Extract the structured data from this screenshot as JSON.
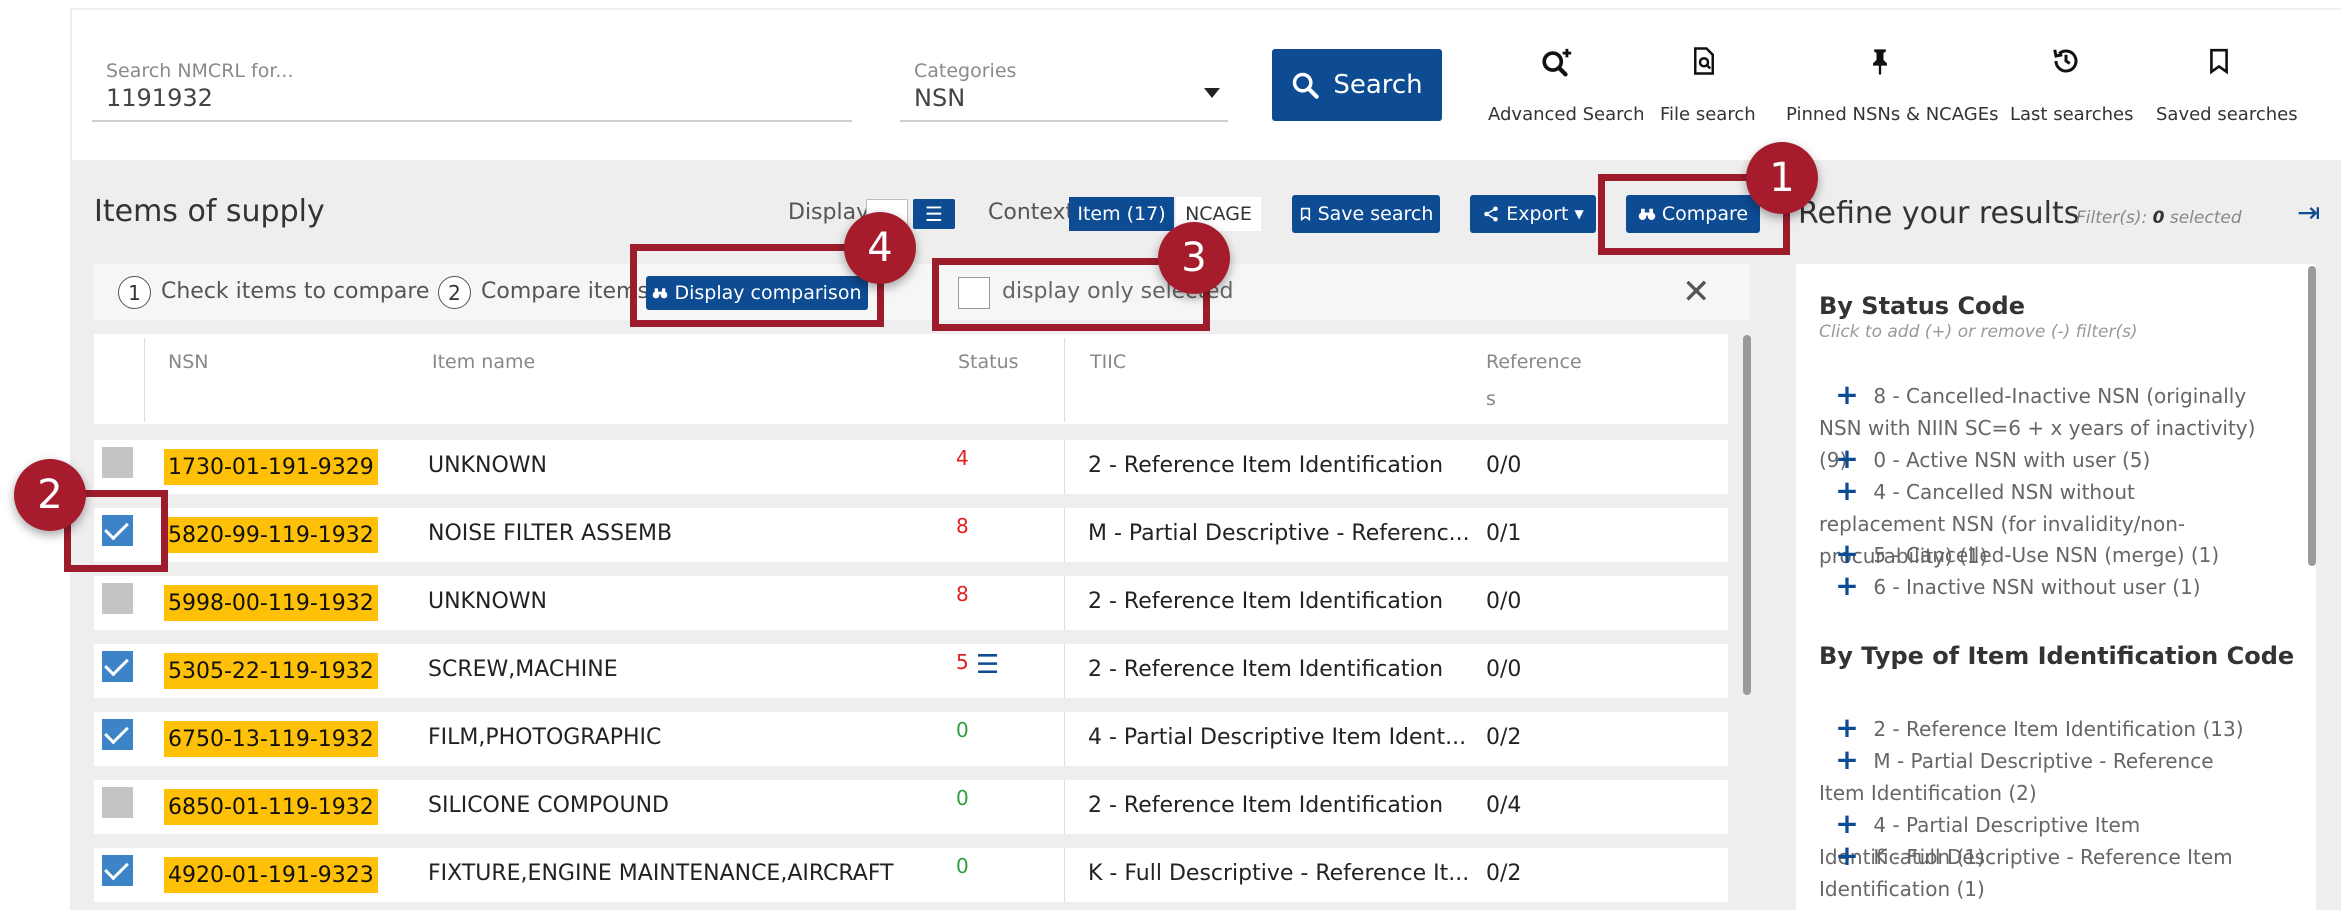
{
  "search": {
    "label": "Search NMCRL for...",
    "value": "1191932"
  },
  "categories": {
    "label": "Categories",
    "value": "NSN"
  },
  "search_button": {
    "label": "Search",
    "icon": "search-icon"
  },
  "tools": [
    {
      "label": "Advanced Search",
      "icon": "advanced-search-icon"
    },
    {
      "label": "File search",
      "icon": "file-search-icon"
    },
    {
      "label": "Pinned NSNs & NCAGEs",
      "icon": "pin-icon"
    },
    {
      "label": "Last searches",
      "icon": "history-icon"
    },
    {
      "label": "Saved searches",
      "icon": "bookmark-icon"
    }
  ],
  "items_panel": {
    "title": "Items of supply",
    "display_label": "Display",
    "context_label": "Context",
    "context_tabs": [
      "Item (17)",
      "NCAGE"
    ],
    "save_search": "Save search",
    "export": "Export",
    "compare": "Compare"
  },
  "steps": {
    "step1_num": "1",
    "step1": "Check items to compare",
    "step2_num": "2",
    "step2": "Compare items",
    "display_comparison": "Display comparison",
    "only_selected": "display only selected"
  },
  "table": {
    "headers": {
      "nsn": "NSN",
      "item_name": "Item name",
      "status": "Status",
      "tiic": "TIIC",
      "references": "Reference",
      "references_wrap": "s"
    },
    "rows": [
      {
        "checked": false,
        "nsn": "1730-01-191-9329",
        "name": "UNKNOWN",
        "status": "4",
        "status_color": "#e02020",
        "tiic": "2 - Reference Item Identification",
        "refs": "0/0"
      },
      {
        "checked": true,
        "nsn": "5820-99-119-1932",
        "name": "NOISE FILTER ASSEMB",
        "status": "8",
        "status_color": "#e02020",
        "tiic": "M - Partial Descriptive - Referenc...",
        "refs": "0/1"
      },
      {
        "checked": false,
        "nsn": "5998-00-119-1932",
        "name": "UNKNOWN",
        "status": "8",
        "status_color": "#e02020",
        "tiic": "2 - Reference Item Identification",
        "refs": "0/0"
      },
      {
        "checked": true,
        "nsn": "5305-22-119-1932",
        "name": "SCREW,MACHINE",
        "status": "5",
        "status_color": "#e02020",
        "tiic": "2 - Reference Item Identification",
        "refs": "0/0"
      },
      {
        "checked": true,
        "nsn": "6750-13-119-1932",
        "name": "FILM,PHOTOGRAPHIC",
        "status": "0",
        "status_color": "#2ea043",
        "tiic": "4 - Partial Descriptive Item Ident...",
        "refs": "0/2"
      },
      {
        "checked": false,
        "nsn": "6850-01-119-1932",
        "name": "SILICONE COMPOUND",
        "status": "0",
        "status_color": "#2ea043",
        "tiic": "2 - Reference Item Identification",
        "refs": "0/4"
      },
      {
        "checked": true,
        "nsn": "4920-01-191-9323",
        "name": "FIXTURE,ENGINE MAINTENANCE,AIRCRAFT",
        "status": "0",
        "status_color": "#2ea043",
        "tiic": "K - Full Descriptive - Reference It...",
        "refs": "0/2"
      }
    ]
  },
  "refine": {
    "title": "Refine your results",
    "filters_label": "Filter(s):",
    "filters_count": "0",
    "filters_suffix": "selected",
    "status_code": {
      "title": "By Status Code",
      "hint": "Click to add (+) or remove (-) filter(s)",
      "items": [
        "8 - Cancelled-Inactive NSN (originally NSN with NIIN SC=6 + x years of inactivity) (9)",
        "0 - Active NSN with user (5)",
        "4 - Cancelled NSN without replacement NSN (for invalidity/non-procurability) (1)",
        "5 - Cancelled-Use NSN (merge) (1)",
        "6 - Inactive NSN without user (1)"
      ]
    },
    "tiic": {
      "title": "By Type of Item Identification Code",
      "items": [
        "2 - Reference Item Identification (13)",
        "M - Partial Descriptive - Reference Item Identification (2)",
        "4 - Partial Descriptive Item Identification (1)",
        "K - Full Descriptive - Reference Item Identification (1)"
      ]
    }
  },
  "callouts": [
    "1",
    "2",
    "3",
    "4"
  ],
  "colors": {
    "primary": "#0d4b93",
    "highlight": "#ffc107",
    "callout": "#a61c2d",
    "checkbox": "#3d83c7"
  }
}
